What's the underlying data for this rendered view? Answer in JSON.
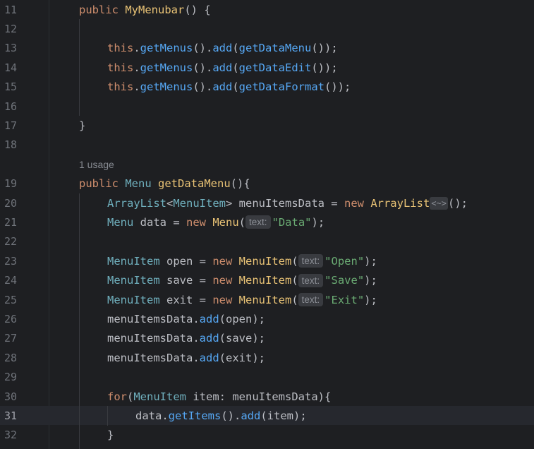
{
  "lines": [
    {
      "num": "11",
      "indent": 0,
      "tokens": [
        [
          "kw",
          "public "
        ],
        [
          "decl",
          "MyMenubar"
        ],
        [
          "var",
          "() {"
        ]
      ]
    },
    {
      "num": "12",
      "indent": 0,
      "tokens": []
    },
    {
      "num": "13",
      "indent": 1,
      "tokens": [
        [
          "this",
          "this"
        ],
        [
          "var",
          "."
        ],
        [
          "mcall",
          "getMenus"
        ],
        [
          "var",
          "()."
        ],
        [
          "mcall",
          "add"
        ],
        [
          "var",
          "("
        ],
        [
          "mcall",
          "getDataMenu"
        ],
        [
          "var",
          "());"
        ]
      ]
    },
    {
      "num": "14",
      "indent": 1,
      "tokens": [
        [
          "this",
          "this"
        ],
        [
          "var",
          "."
        ],
        [
          "mcall",
          "getMenus"
        ],
        [
          "var",
          "()."
        ],
        [
          "mcall",
          "add"
        ],
        [
          "var",
          "("
        ],
        [
          "mcall",
          "getDataEdit"
        ],
        [
          "var",
          "());"
        ]
      ]
    },
    {
      "num": "15",
      "indent": 1,
      "tokens": [
        [
          "this",
          "this"
        ],
        [
          "var",
          "."
        ],
        [
          "mcall",
          "getMenus"
        ],
        [
          "var",
          "()."
        ],
        [
          "mcall",
          "add"
        ],
        [
          "var",
          "("
        ],
        [
          "mcall",
          "getDataFormat"
        ],
        [
          "var",
          "());"
        ]
      ]
    },
    {
      "num": "16",
      "indent": 0,
      "tokens": []
    },
    {
      "num": "17",
      "indent": 0,
      "tokens": [
        [
          "var",
          "}"
        ]
      ]
    },
    {
      "num": "18",
      "indent": 0,
      "tokens": []
    },
    {
      "num": "",
      "indent": 0,
      "usage": "1 usage",
      "tokens": []
    },
    {
      "num": "19",
      "indent": 0,
      "tokens": [
        [
          "kw",
          "public "
        ],
        [
          "typ",
          "Menu "
        ],
        [
          "decl",
          "getDataMenu"
        ],
        [
          "var",
          "(){"
        ]
      ]
    },
    {
      "num": "20",
      "indent": 1,
      "tokens": [
        [
          "typ",
          "ArrayList"
        ],
        [
          "var",
          "<"
        ],
        [
          "typ",
          "MenuItem"
        ],
        [
          "var",
          "> menuItemsData = "
        ],
        [
          "kw",
          "new "
        ],
        [
          "decl",
          "ArrayList"
        ],
        [
          "diamond",
          "<~>"
        ],
        [
          "var",
          "();"
        ]
      ]
    },
    {
      "num": "21",
      "indent": 1,
      "tokens": [
        [
          "typ",
          "Menu "
        ],
        [
          "var",
          "data = "
        ],
        [
          "kw",
          "new "
        ],
        [
          "decl",
          "Menu"
        ],
        [
          "var",
          "("
        ],
        [
          "hint",
          "text:"
        ],
        [
          "str",
          "\"Data\""
        ],
        [
          "var",
          ");"
        ]
      ]
    },
    {
      "num": "22",
      "indent": 0,
      "tokens": []
    },
    {
      "num": "23",
      "indent": 1,
      "tokens": [
        [
          "typ",
          "MenuItem "
        ],
        [
          "var",
          "open = "
        ],
        [
          "kw",
          "new "
        ],
        [
          "decl",
          "MenuItem"
        ],
        [
          "var",
          "("
        ],
        [
          "hint",
          "text:"
        ],
        [
          "str",
          "\"Open\""
        ],
        [
          "var",
          ");"
        ]
      ]
    },
    {
      "num": "24",
      "indent": 1,
      "tokens": [
        [
          "typ",
          "MenuItem "
        ],
        [
          "var",
          "save = "
        ],
        [
          "kw",
          "new "
        ],
        [
          "decl",
          "MenuItem"
        ],
        [
          "var",
          "("
        ],
        [
          "hint",
          "text:"
        ],
        [
          "str",
          "\"Save\""
        ],
        [
          "var",
          ");"
        ]
      ]
    },
    {
      "num": "25",
      "indent": 1,
      "tokens": [
        [
          "typ",
          "MenuItem "
        ],
        [
          "var",
          "exit = "
        ],
        [
          "kw",
          "new "
        ],
        [
          "decl",
          "MenuItem"
        ],
        [
          "var",
          "("
        ],
        [
          "hint",
          "text:"
        ],
        [
          "str",
          "\"Exit\""
        ],
        [
          "var",
          ");"
        ]
      ]
    },
    {
      "num": "26",
      "indent": 1,
      "tokens": [
        [
          "var",
          "menuItemsData."
        ],
        [
          "mcall",
          "add"
        ],
        [
          "var",
          "(open);"
        ]
      ]
    },
    {
      "num": "27",
      "indent": 1,
      "tokens": [
        [
          "var",
          "menuItemsData."
        ],
        [
          "mcall",
          "add"
        ],
        [
          "var",
          "(save);"
        ]
      ]
    },
    {
      "num": "28",
      "indent": 1,
      "tokens": [
        [
          "var",
          "menuItemsData."
        ],
        [
          "mcall",
          "add"
        ],
        [
          "var",
          "(exit);"
        ]
      ]
    },
    {
      "num": "29",
      "indent": 0,
      "tokens": []
    },
    {
      "num": "30",
      "indent": 1,
      "tokens": [
        [
          "kw",
          "for"
        ],
        [
          "var",
          "("
        ],
        [
          "typ",
          "MenuItem "
        ],
        [
          "var",
          "item: menuItemsData){"
        ]
      ]
    },
    {
      "num": "31",
      "indent": 2,
      "current": true,
      "tokens": [
        [
          "var",
          "data."
        ],
        [
          "mcall",
          "getItems"
        ],
        [
          "var",
          "()."
        ],
        [
          "mcall",
          "add"
        ],
        [
          "var",
          "(item);"
        ]
      ]
    },
    {
      "num": "32",
      "indent": 1,
      "tokens": [
        [
          "var",
          "}"
        ]
      ]
    }
  ]
}
